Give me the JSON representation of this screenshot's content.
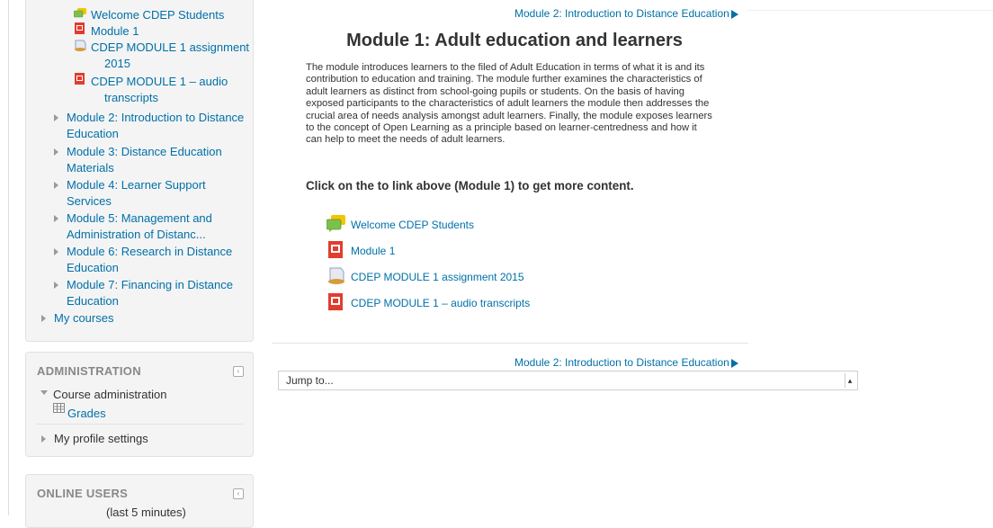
{
  "sidebar": {
    "nav_resources": [
      {
        "label": "Welcome CDEP Students",
        "icon": "forum-icon"
      },
      {
        "label": "Module 1",
        "icon": "pdf-icon"
      },
      {
        "label_lines": [
          "CDEP MODULE 1 assignment",
          "2015"
        ],
        "icon": "assignment-icon"
      },
      {
        "label_lines": [
          "CDEP MODULE 1 – audio",
          "transcripts"
        ],
        "icon": "pdf-icon"
      }
    ],
    "modules": [
      "Module 2: Introduction to Distance Education",
      "Module 3: Distance Education Materials",
      "Module 4: Learner Support Services",
      "Module 5: Management and Administration of Distanc...",
      "Module 6: Research in Distance Education",
      "Module 7: Financing in Distance Education"
    ],
    "my_courses": "My courses",
    "administration": {
      "title": "ADMINISTRATION",
      "course_admin": "Course administration",
      "grades": "Grades",
      "profile": "My profile settings"
    },
    "online_users": {
      "title": "ONLINE USERS",
      "subtitle": "(last 5 minutes)"
    }
  },
  "main": {
    "top_nav_link": "Module 2: Introduction to Distance Education",
    "title": "Module 1: Adult education and learners",
    "summary": "The module introduces learners to the filed of Adult Education in terms of what it is and its contribution to education and training. The module further examines the characteristics of adult learners as distinct from school-going pupils or students. On the basis of having exposed participants to the characteristics of adult learners the module then addresses the crucial area of needs analysis amongst adult learners. Finally, the module exposes learners to the concept of Open Learning as a principle based on learner-centredness and how it can help to meet the needs of adult learners.",
    "click_note": "Click on the to link above (Module 1) to get more content.",
    "activities": [
      {
        "label": "Welcome CDEP Students",
        "icon": "forum-icon"
      },
      {
        "label": "Module 1",
        "icon": "pdf-icon"
      },
      {
        "label": "CDEP MODULE 1 assignment 2015",
        "icon": "assignment-icon"
      },
      {
        "label": "CDEP MODULE 1 – audio transcripts",
        "icon": "pdf-icon"
      }
    ],
    "bottom_nav_link": "Module 2: Introduction to Distance Education",
    "jump_to": "Jump to..."
  },
  "colors": {
    "link": "#0070a8",
    "text": "#333333",
    "block_bg": "#f4f4f4"
  }
}
